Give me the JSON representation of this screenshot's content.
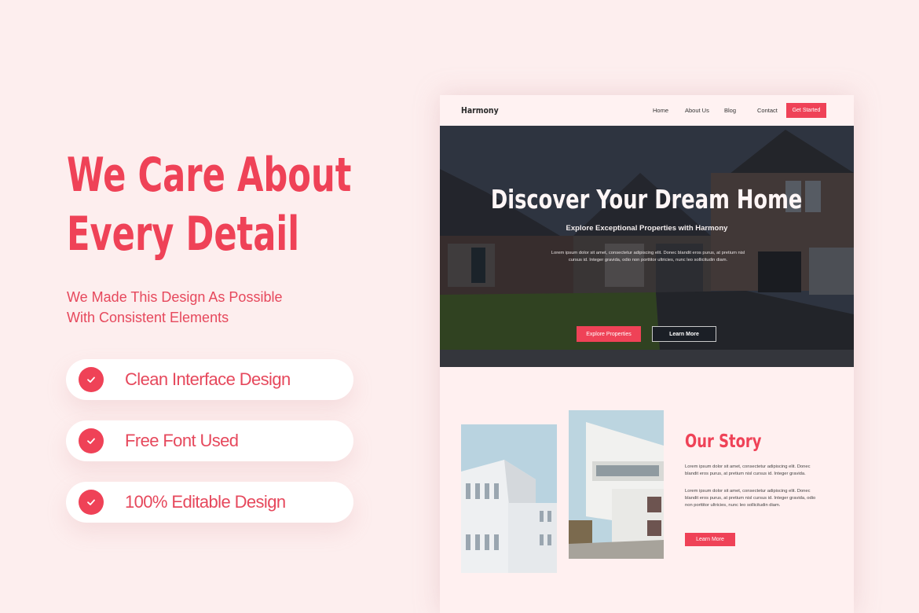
{
  "promo": {
    "title_line1": "We Care About",
    "title_line2": "Every Detail",
    "subtitle_line1": "We Made This Design As Possible",
    "subtitle_line2": "With Consistent Elements",
    "features": [
      {
        "label": "Clean Interface Design",
        "icon": "check-icon"
      },
      {
        "label": "Free Font Used",
        "icon": "check-icon"
      },
      {
        "label": "100% Editable Design",
        "icon": "check-icon"
      }
    ]
  },
  "mockup": {
    "nav": {
      "logo": "Harmony",
      "links": [
        "Home",
        "About Us",
        "Blog",
        "Contact"
      ],
      "cta": "Get Started"
    },
    "hero": {
      "title": "Discover Your Dream Home",
      "subtitle": "Explore Exceptional Properties with Harmony",
      "body": "Lorem ipsum dolor sit amet, consectetur adipiscing elit. Donec blandit eros purus, at pretium nisl cursus id. Integer gravida, odio non porttitor ultricies, nunc leo sollicitudin diam.",
      "primary_button": "Explore Properties",
      "secondary_button": "Learn More"
    },
    "story": {
      "title": "Our Story",
      "paragraph1": "Lorem ipsum dolor sit amet, consectetur adipiscing elit. Donec blandit eros purus, at pretium nisl cursus id. Integer gravida.",
      "paragraph2": "Lorem ipsum dolor sit amet, consectetur adipiscing elit. Donec blandit eros purus, at pretium nisl cursus id. Integer gravida, odio non porttitor ultricies, nunc leo sollicitudin diam.",
      "button": "Learn More"
    }
  },
  "colors": {
    "accent": "#ef4257",
    "background": "#fdeeee",
    "card": "#ffffff"
  }
}
